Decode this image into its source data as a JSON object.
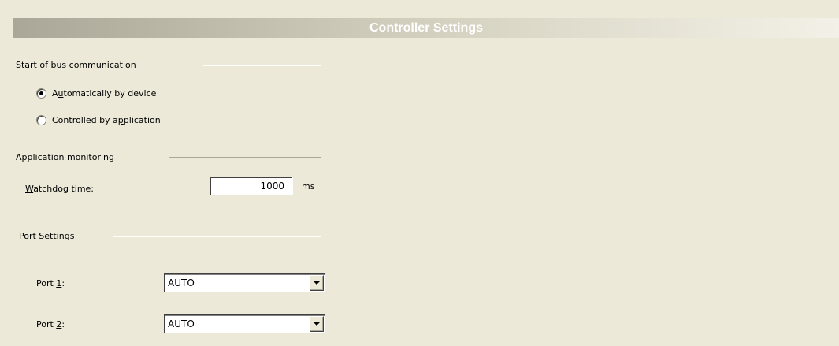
{
  "header": {
    "title": "Controller Settings"
  },
  "bus_group": {
    "label": "Start of bus communication",
    "options": [
      {
        "pre": "A",
        "key": "u",
        "post": "tomatically by device",
        "selected": true
      },
      {
        "pre": "Controlled by a",
        "key": "p",
        "post": "plication",
        "selected": false
      }
    ]
  },
  "monitoring_group": {
    "label": "Application monitoring",
    "watchdog": {
      "key": "W",
      "label_rest": "atchdog time:",
      "value": "1000",
      "unit": "ms"
    }
  },
  "port_group": {
    "label": "Port Settings",
    "ports": [
      {
        "label_pre": "Port ",
        "key": "1",
        "label_post": ":",
        "value": "AUTO"
      },
      {
        "label_pre": "Port ",
        "key": "2",
        "label_post": ":",
        "value": "AUTO"
      }
    ]
  },
  "icons": {
    "radio": "radio-button",
    "dropdown": "chevron-down-icon"
  }
}
